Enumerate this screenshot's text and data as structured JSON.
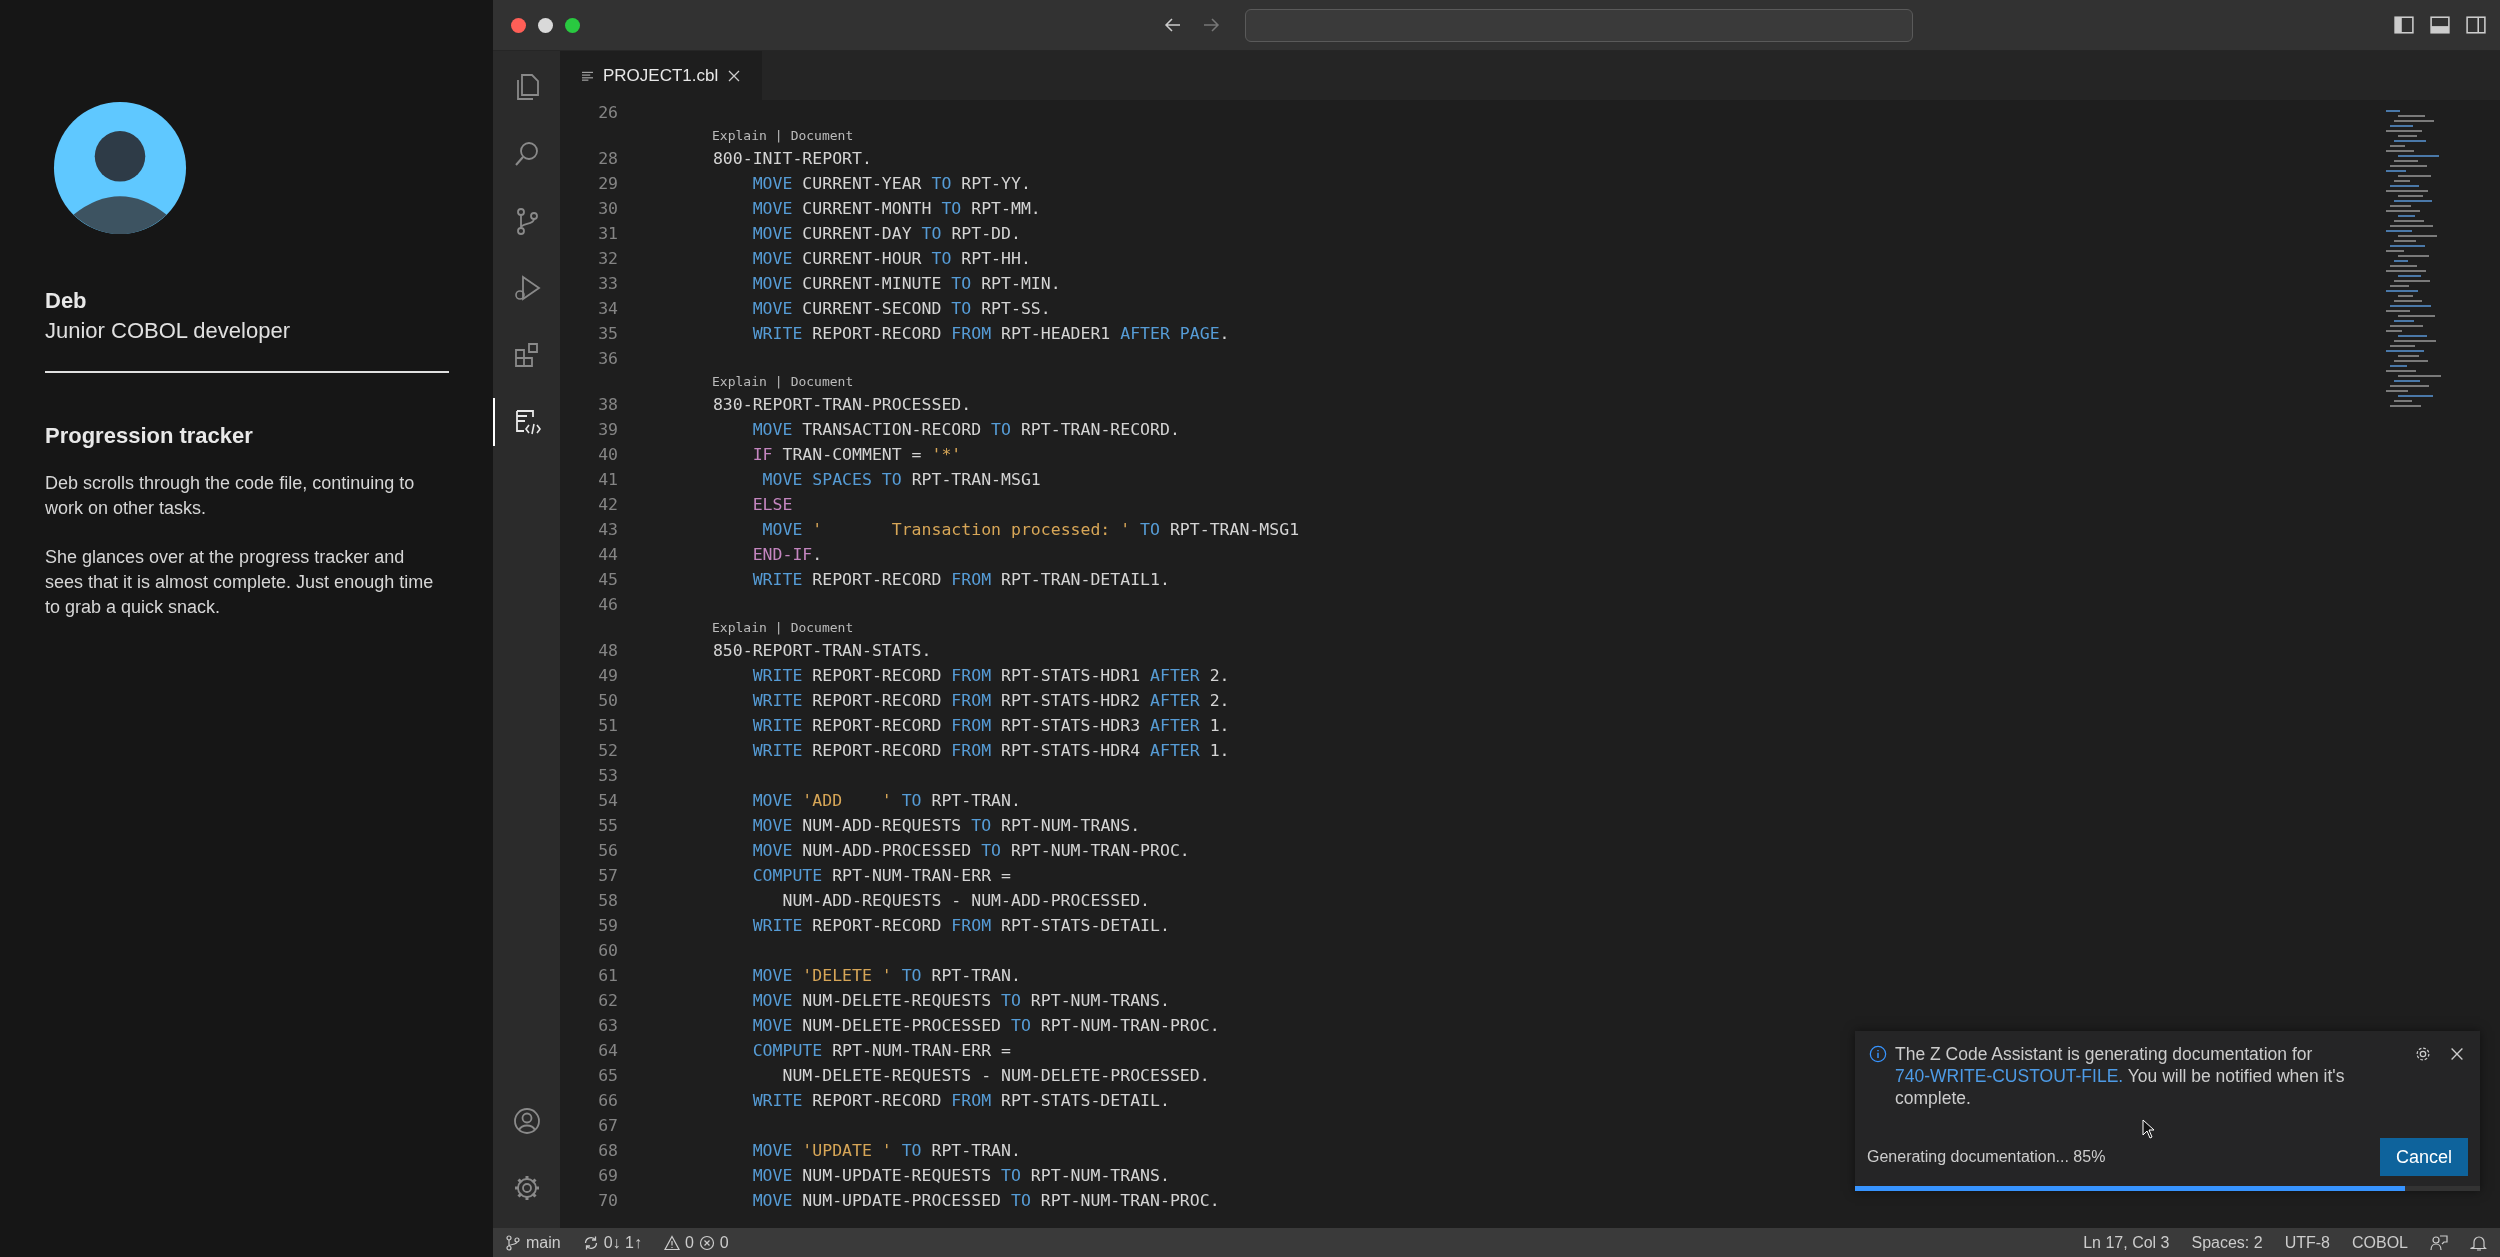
{
  "story_panel": {
    "name": "Deb",
    "role": "Junior COBOL developer",
    "heading": "Progression tracker",
    "paragraphs": [
      "Deb scrolls through the code file, continuing to work on other tasks.",
      "She glances over at the progress tracker and sees that it is almost complete. Just enough time to grab a quick snack."
    ]
  },
  "activity_bar": {
    "items": [
      {
        "kind": "files",
        "selected": false
      },
      {
        "kind": "search",
        "selected": false
      },
      {
        "kind": "source-control",
        "selected": false
      },
      {
        "kind": "run",
        "selected": false
      },
      {
        "kind": "extensions",
        "selected": false
      },
      {
        "kind": "assistant",
        "selected": true
      }
    ],
    "bottom": [
      {
        "kind": "account"
      },
      {
        "kind": "settings"
      }
    ]
  },
  "tabs": [
    {
      "label": "PROJECT1.cbl",
      "selected": true
    }
  ],
  "editor": {
    "lines": [
      {
        "kind": "code",
        "number": "26"
      },
      {
        "kind": "lens",
        "actions": [
          "Explain",
          "Document"
        ],
        "separator": "|"
      },
      {
        "kind": "code",
        "number": "28",
        "tokens": [
          {
            "kind": "plain",
            "text": " 800-INIT-REPORT."
          }
        ]
      },
      {
        "kind": "code",
        "number": "29",
        "tokens": [
          {
            "kind": "keyword",
            "text": "     MOVE "
          },
          {
            "kind": "plain",
            "text": "CURRENT-YEAR "
          },
          {
            "kind": "keyword",
            "text": "TO "
          },
          {
            "kind": "plain",
            "text": "RPT-YY."
          }
        ]
      },
      {
        "kind": "code",
        "number": "30",
        "tokens": [
          {
            "kind": "keyword",
            "text": "     MOVE "
          },
          {
            "kind": "plain",
            "text": "CURRENT-MONTH "
          },
          {
            "kind": "keyword",
            "text": "TO "
          },
          {
            "kind": "plain",
            "text": "RPT-MM."
          }
        ]
      },
      {
        "kind": "code",
        "number": "31",
        "tokens": [
          {
            "kind": "keyword",
            "text": "     MOVE "
          },
          {
            "kind": "plain",
            "text": "CURRENT-DAY "
          },
          {
            "kind": "keyword",
            "text": "TO "
          },
          {
            "kind": "plain",
            "text": "RPT-DD."
          }
        ]
      },
      {
        "kind": "code",
        "number": "32",
        "tokens": [
          {
            "kind": "keyword",
            "text": "     MOVE "
          },
          {
            "kind": "plain",
            "text": "CURRENT-HOUR "
          },
          {
            "kind": "keyword",
            "text": "TO "
          },
          {
            "kind": "plain",
            "text": "RPT-HH."
          }
        ]
      },
      {
        "kind": "code",
        "number": "33",
        "tokens": [
          {
            "kind": "keyword",
            "text": "     MOVE "
          },
          {
            "kind": "plain",
            "text": "CURRENT-MINUTE "
          },
          {
            "kind": "keyword",
            "text": "TO "
          },
          {
            "kind": "plain",
            "text": "RPT-MIN."
          }
        ]
      },
      {
        "kind": "code",
        "number": "34",
        "tokens": [
          {
            "kind": "keyword",
            "text": "     MOVE "
          },
          {
            "kind": "plain",
            "text": "CURRENT-SECOND "
          },
          {
            "kind": "keyword",
            "text": "TO "
          },
          {
            "kind": "plain",
            "text": "RPT-SS."
          }
        ]
      },
      {
        "kind": "code",
        "number": "35",
        "tokens": [
          {
            "kind": "keyword",
            "text": "     WRITE "
          },
          {
            "kind": "plain",
            "text": "REPORT-RECORD "
          },
          {
            "kind": "keyword",
            "text": "FROM "
          },
          {
            "kind": "plain",
            "text": "RPT-HEADER1 "
          },
          {
            "kind": "keyword",
            "text": "AFTER PAGE"
          },
          {
            "kind": "plain",
            "text": "."
          }
        ]
      },
      {
        "kind": "code",
        "number": "36"
      },
      {
        "kind": "lens",
        "actions": [
          "Explain",
          "Document"
        ],
        "separator": "|"
      },
      {
        "kind": "code",
        "number": "38",
        "tokens": [
          {
            "kind": "plain",
            "text": " 830-REPORT-TRAN-PROCESSED."
          }
        ]
      },
      {
        "kind": "code",
        "number": "39",
        "tokens": [
          {
            "kind": "keyword",
            "text": "     MOVE "
          },
          {
            "kind": "plain",
            "text": "TRANSACTION-RECORD "
          },
          {
            "kind": "keyword",
            "text": "TO "
          },
          {
            "kind": "plain",
            "text": "RPT-TRAN-RECORD."
          }
        ]
      },
      {
        "kind": "code",
        "number": "40",
        "tokens": [
          {
            "kind": "control",
            "text": "     IF "
          },
          {
            "kind": "plain",
            "text": "TRAN-COMMENT = "
          },
          {
            "kind": "string",
            "text": "'*'"
          }
        ]
      },
      {
        "kind": "code",
        "number": "41",
        "tokens": [
          {
            "kind": "keyword",
            "text": "      MOVE SPACES TO "
          },
          {
            "kind": "plain",
            "text": "RPT-TRAN-MSG1"
          }
        ]
      },
      {
        "kind": "code",
        "number": "42",
        "tokens": [
          {
            "kind": "control",
            "text": "     ELSE"
          }
        ]
      },
      {
        "kind": "code",
        "number": "43",
        "tokens": [
          {
            "kind": "keyword",
            "text": "      MOVE "
          },
          {
            "kind": "string",
            "text": "'       Transaction processed: ' "
          },
          {
            "kind": "keyword",
            "text": "TO "
          },
          {
            "kind": "plain",
            "text": "RPT-TRAN-MSG1"
          }
        ]
      },
      {
        "kind": "code",
        "number": "44",
        "tokens": [
          {
            "kind": "control",
            "text": "     END-IF"
          },
          {
            "kind": "plain",
            "text": "."
          }
        ]
      },
      {
        "kind": "code",
        "number": "45",
        "tokens": [
          {
            "kind": "keyword",
            "text": "     WRITE "
          },
          {
            "kind": "plain",
            "text": "REPORT-RECORD "
          },
          {
            "kind": "keyword",
            "text": "FROM "
          },
          {
            "kind": "plain",
            "text": "RPT-TRAN-DETAIL1."
          }
        ]
      },
      {
        "kind": "code",
        "number": "46"
      },
      {
        "kind": "lens",
        "actions": [
          "Explain",
          "Document"
        ],
        "separator": "|"
      },
      {
        "kind": "code",
        "number": "48",
        "tokens": [
          {
            "kind": "plain",
            "text": " 850-REPORT-TRAN-STATS."
          }
        ]
      },
      {
        "kind": "code",
        "number": "49",
        "tokens": [
          {
            "kind": "keyword",
            "text": "     WRITE "
          },
          {
            "kind": "plain",
            "text": "REPORT-RECORD "
          },
          {
            "kind": "keyword",
            "text": "FROM "
          },
          {
            "kind": "plain",
            "text": "RPT-STATS-HDR1 "
          },
          {
            "kind": "keyword",
            "text": "AFTER "
          },
          {
            "kind": "plain",
            "text": "2."
          }
        ]
      },
      {
        "kind": "code",
        "number": "50",
        "tokens": [
          {
            "kind": "keyword",
            "text": "     WRITE "
          },
          {
            "kind": "plain",
            "text": "REPORT-RECORD "
          },
          {
            "kind": "keyword",
            "text": "FROM "
          },
          {
            "kind": "plain",
            "text": "RPT-STATS-HDR2 "
          },
          {
            "kind": "keyword",
            "text": "AFTER "
          },
          {
            "kind": "plain",
            "text": "2."
          }
        ]
      },
      {
        "kind": "code",
        "number": "51",
        "tokens": [
          {
            "kind": "keyword",
            "text": "     WRITE "
          },
          {
            "kind": "plain",
            "text": "REPORT-RECORD "
          },
          {
            "kind": "keyword",
            "text": "FROM "
          },
          {
            "kind": "plain",
            "text": "RPT-STATS-HDR3 "
          },
          {
            "kind": "keyword",
            "text": "AFTER "
          },
          {
            "kind": "plain",
            "text": "1."
          }
        ]
      },
      {
        "kind": "code",
        "number": "52",
        "tokens": [
          {
            "kind": "keyword",
            "text": "     WRITE "
          },
          {
            "kind": "plain",
            "text": "REPORT-RECORD "
          },
          {
            "kind": "keyword",
            "text": "FROM "
          },
          {
            "kind": "plain",
            "text": "RPT-STATS-HDR4 "
          },
          {
            "kind": "keyword",
            "text": "AFTER "
          },
          {
            "kind": "plain",
            "text": "1."
          }
        ]
      },
      {
        "kind": "code",
        "number": "53"
      },
      {
        "kind": "code",
        "number": "54",
        "tokens": [
          {
            "kind": "keyword",
            "text": "     MOVE "
          },
          {
            "kind": "string",
            "text": "'ADD    ' "
          },
          {
            "kind": "keyword",
            "text": "TO "
          },
          {
            "kind": "plain",
            "text": "RPT-TRAN."
          }
        ]
      },
      {
        "kind": "code",
        "number": "55",
        "tokens": [
          {
            "kind": "keyword",
            "text": "     MOVE "
          },
          {
            "kind": "plain",
            "text": "NUM-ADD-REQUESTS "
          },
          {
            "kind": "keyword",
            "text": "TO "
          },
          {
            "kind": "plain",
            "text": "RPT-NUM-TRANS."
          }
        ]
      },
      {
        "kind": "code",
        "number": "56",
        "tokens": [
          {
            "kind": "keyword",
            "text": "     MOVE "
          },
          {
            "kind": "plain",
            "text": "NUM-ADD-PROCESSED "
          },
          {
            "kind": "keyword",
            "text": "TO "
          },
          {
            "kind": "plain",
            "text": "RPT-NUM-TRAN-PROC."
          }
        ]
      },
      {
        "kind": "code",
        "number": "57",
        "tokens": [
          {
            "kind": "keyword",
            "text": "     COMPUTE "
          },
          {
            "kind": "plain",
            "text": "RPT-NUM-TRAN-ERR ="
          }
        ]
      },
      {
        "kind": "code",
        "number": "58",
        "tokens": [
          {
            "kind": "plain",
            "text": "        NUM-ADD-REQUESTS - NUM-ADD-PROCESSED."
          }
        ]
      },
      {
        "kind": "code",
        "number": "59",
        "tokens": [
          {
            "kind": "keyword",
            "text": "     WRITE "
          },
          {
            "kind": "plain",
            "text": "REPORT-RECORD "
          },
          {
            "kind": "keyword",
            "text": "FROM "
          },
          {
            "kind": "plain",
            "text": "RPT-STATS-DETAIL."
          }
        ]
      },
      {
        "kind": "code",
        "number": "60"
      },
      {
        "kind": "code",
        "number": "61",
        "tokens": [
          {
            "kind": "keyword",
            "text": "     MOVE "
          },
          {
            "kind": "string",
            "text": "'DELETE ' "
          },
          {
            "kind": "keyword",
            "text": "TO "
          },
          {
            "kind": "plain",
            "text": "RPT-TRAN."
          }
        ]
      },
      {
        "kind": "code",
        "number": "62",
        "tokens": [
          {
            "kind": "keyword",
            "text": "     MOVE "
          },
          {
            "kind": "plain",
            "text": "NUM-DELETE-REQUESTS "
          },
          {
            "kind": "keyword",
            "text": "TO "
          },
          {
            "kind": "plain",
            "text": "RPT-NUM-TRANS."
          }
        ]
      },
      {
        "kind": "code",
        "number": "63",
        "tokens": [
          {
            "kind": "keyword",
            "text": "     MOVE "
          },
          {
            "kind": "plain",
            "text": "NUM-DELETE-PROCESSED "
          },
          {
            "kind": "keyword",
            "text": "TO "
          },
          {
            "kind": "plain",
            "text": "RPT-NUM-TRAN-PROC."
          }
        ]
      },
      {
        "kind": "code",
        "number": "64",
        "tokens": [
          {
            "kind": "keyword",
            "text": "     COMPUTE "
          },
          {
            "kind": "plain",
            "text": "RPT-NUM-TRAN-ERR ="
          }
        ]
      },
      {
        "kind": "code",
        "number": "65",
        "tokens": [
          {
            "kind": "plain",
            "text": "        NUM-DELETE-REQUESTS - NUM-DELETE-PROCESSED."
          }
        ]
      },
      {
        "kind": "code",
        "number": "66",
        "tokens": [
          {
            "kind": "keyword",
            "text": "     WRITE "
          },
          {
            "kind": "plain",
            "text": "REPORT-RECORD "
          },
          {
            "kind": "keyword",
            "text": "FROM "
          },
          {
            "kind": "plain",
            "text": "RPT-STATS-DETAIL."
          }
        ]
      },
      {
        "kind": "code",
        "number": "67"
      },
      {
        "kind": "code",
        "number": "68",
        "tokens": [
          {
            "kind": "keyword",
            "text": "     MOVE "
          },
          {
            "kind": "string",
            "text": "'UPDATE ' "
          },
          {
            "kind": "keyword",
            "text": "TO "
          },
          {
            "kind": "plain",
            "text": "RPT-TRAN."
          }
        ]
      },
      {
        "kind": "code",
        "number": "69",
        "tokens": [
          {
            "kind": "keyword",
            "text": "     MOVE "
          },
          {
            "kind": "plain",
            "text": "NUM-UPDATE-REQUESTS "
          },
          {
            "kind": "keyword",
            "text": "TO "
          },
          {
            "kind": "plain",
            "text": "RPT-NUM-TRANS."
          }
        ]
      },
      {
        "kind": "code",
        "number": "70",
        "tokens": [
          {
            "kind": "keyword",
            "text": "     MOVE "
          },
          {
            "kind": "plain",
            "text": "NUM-UPDATE-PROCESSED "
          },
          {
            "kind": "keyword",
            "text": "TO "
          },
          {
            "kind": "plain",
            "text": "RPT-NUM-TRAN-PROC."
          }
        ]
      }
    ]
  },
  "notification": {
    "message_before": "The Z Code Assistant is generating documentation for",
    "link": "740-WRITE-CUSTOUT-FILE.",
    "message_after": "You will be notified when it's complete.",
    "status": "Generating documentation... 85%",
    "button": "Cancel",
    "level": 0.88
  },
  "status_bar": {
    "branch": "main",
    "sync": "0↓ 1↑",
    "warnings": "0",
    "errors": "0",
    "items": [
      "Ln 17, Col 3",
      "Spaces: 2",
      "UTF-8",
      "COBOL"
    ]
  }
}
